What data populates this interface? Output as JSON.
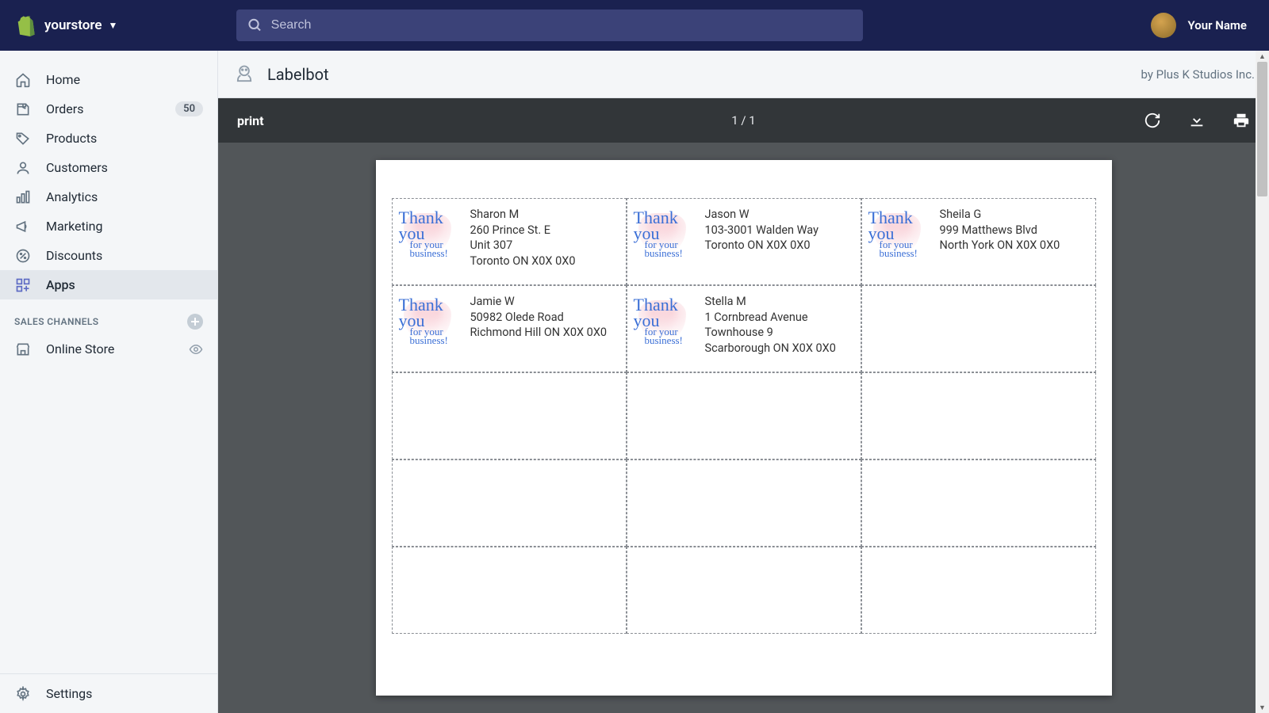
{
  "topbar": {
    "store_name": "yourstore",
    "search_placeholder": "Search",
    "user_name": "Your Name"
  },
  "sidebar": {
    "items": [
      {
        "label": "Home",
        "icon": "home"
      },
      {
        "label": "Orders",
        "icon": "orders",
        "badge": "50"
      },
      {
        "label": "Products",
        "icon": "tag"
      },
      {
        "label": "Customers",
        "icon": "person"
      },
      {
        "label": "Analytics",
        "icon": "bars"
      },
      {
        "label": "Marketing",
        "icon": "megaphone"
      },
      {
        "label": "Discounts",
        "icon": "discount"
      },
      {
        "label": "Apps",
        "icon": "apps"
      }
    ],
    "channels_heading": "SALES CHANNELS",
    "channels": [
      {
        "label": "Online Store",
        "icon": "store"
      }
    ],
    "settings_label": "Settings"
  },
  "app": {
    "title": "Labelbot",
    "by": "by Plus K Studios Inc."
  },
  "viewer": {
    "doc_title": "print",
    "page_count": "1 / 1"
  },
  "labels": [
    {
      "name": "Sharon M",
      "lines": [
        "260 Prince St. E",
        "Unit 307",
        "Toronto ON X0X 0X0"
      ]
    },
    {
      "name": "Jason W",
      "lines": [
        "103-3001 Walden Way",
        "Toronto ON X0X 0X0"
      ]
    },
    {
      "name": "Sheila G",
      "lines": [
        "999 Matthews Blvd",
        "North York ON X0X 0X0"
      ]
    },
    {
      "name": "Jamie W",
      "lines": [
        "50982 Olede Road",
        "Richmond Hill ON X0X 0X0"
      ]
    },
    {
      "name": "Stella M",
      "lines": [
        "1 Cornbread Avenue",
        "Townhouse 9",
        "Scarborough ON X0X 0X0"
      ]
    }
  ],
  "thank_text": {
    "line1": "Thank you",
    "line2": "for your business!"
  }
}
